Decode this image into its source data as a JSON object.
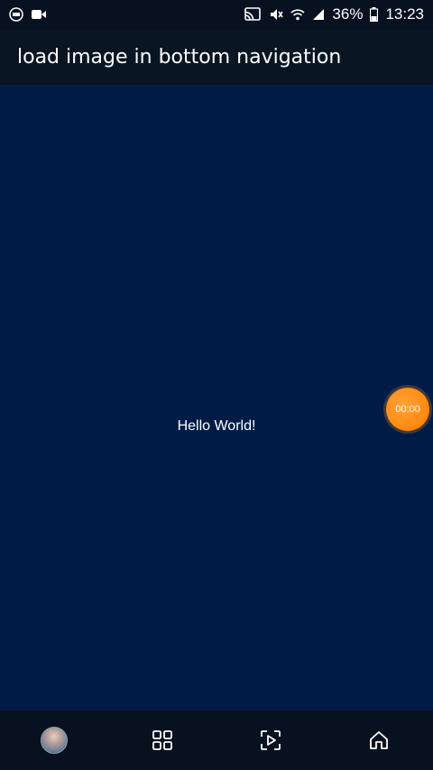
{
  "status_bar": {
    "battery": "36%",
    "time": "13:23",
    "icons": [
      "pip-icon",
      "video-camera-icon",
      "cast-icon",
      "mute-icon",
      "wifi-icon",
      "signal-icon",
      "battery-icon"
    ]
  },
  "app_bar": {
    "title": "load image in bottom navigation"
  },
  "content": {
    "message": "Hello World!"
  },
  "floating_timer": {
    "label": "00:00",
    "color": "#ff8c14"
  },
  "bottom_nav": {
    "items": [
      {
        "name": "profile",
        "icon": "avatar-image"
      },
      {
        "name": "grid",
        "icon": "grid-icon"
      },
      {
        "name": "media",
        "icon": "play-frame-icon"
      },
      {
        "name": "home",
        "icon": "home-icon"
      }
    ]
  },
  "colors": {
    "background": "#001c46",
    "bars": "#07111f",
    "accent": "#ff8c14"
  }
}
